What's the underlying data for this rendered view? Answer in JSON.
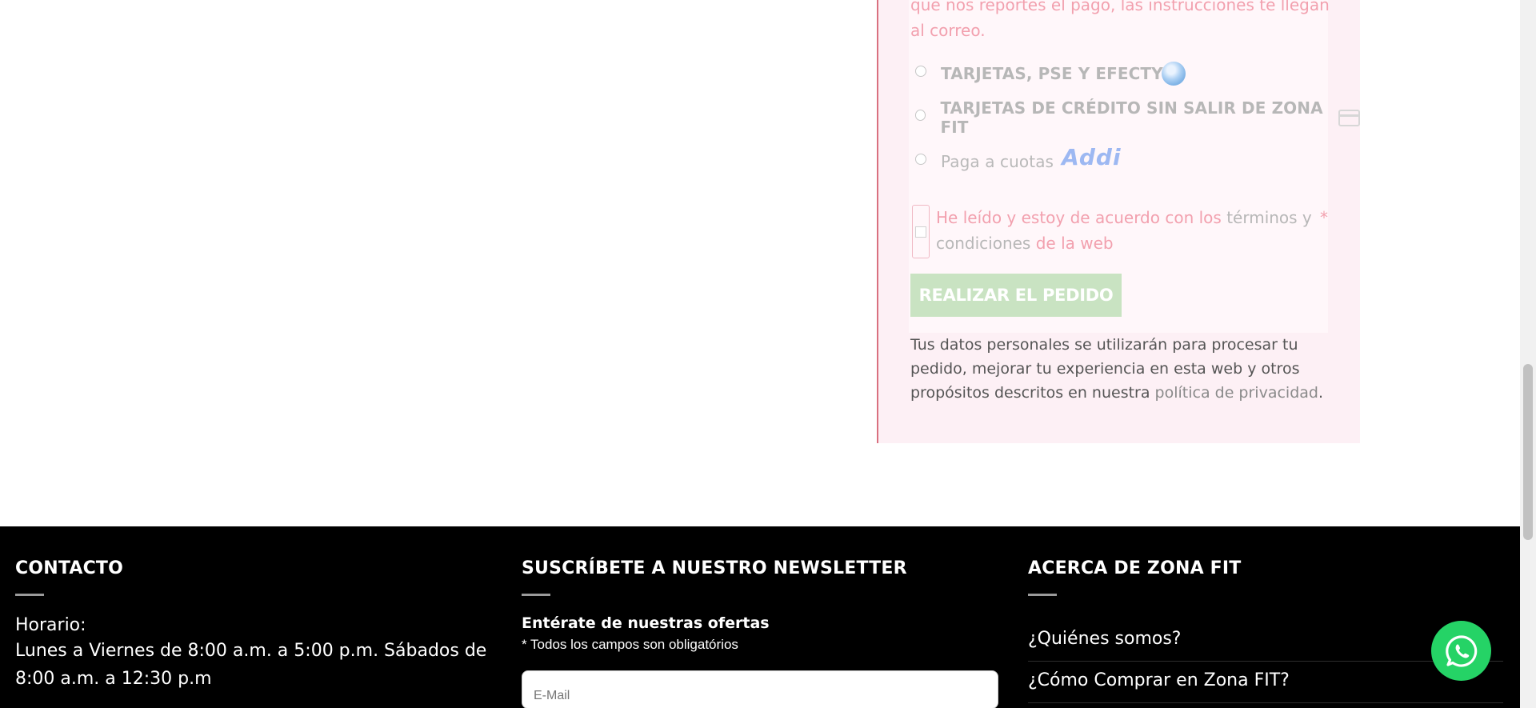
{
  "checkout": {
    "intro": "que nos reportes el pago, las instrucciones te llegan al correo.",
    "payment_options": [
      {
        "label": "TARJETAS, PSE Y EFECTY",
        "icon": "globe-icon"
      },
      {
        "label": "TARJETAS DE CRÉDITO SIN SALIR DE ZONA FIT",
        "icon": "credit-card-icon"
      },
      {
        "label": "Paga a cuotas",
        "icon": "addi-logo"
      }
    ],
    "addi_logo_text": "Addi",
    "terms": {
      "prefix": "He leído y estoy de acuerdo con los ",
      "link": "términos y condiciones",
      "suffix": " de la web",
      "required_mark": "*"
    },
    "order_button": "REALIZAR EL PEDIDO",
    "privacy": {
      "text": "Tus datos personales se utilizarán para procesar tu pedido, mejorar tu experiencia en esta web y otros propósitos descritos en nuestra ",
      "link": "política de privacidad",
      "end": "."
    }
  },
  "footer": {
    "contact": {
      "title": "CONTACTO",
      "hours_label": "Horario:",
      "hours": "Lunes a Viernes de 8:00 a.m. a 5:00 p.m. Sábados de 8:00 a.m. a 12:30 p.m"
    },
    "newsletter": {
      "title": "SUSCRÍBETE A NUESTRO NEWSLETTER",
      "subtitle": "Entérate de nuestras ofertas",
      "note": "* Todos los campos son obligatórios",
      "email_placeholder": "E-Mail"
    },
    "about": {
      "title": "ACERCA DE ZONA FIT",
      "links": [
        "¿Quiénes somos?",
        "¿Cómo Comprar en Zona FIT?"
      ]
    }
  },
  "colors": {
    "accent_pink": "#f2a0ae",
    "button_green": "#c9e3c2",
    "whatsapp_green": "#25d366",
    "footer_bg": "#000000"
  }
}
